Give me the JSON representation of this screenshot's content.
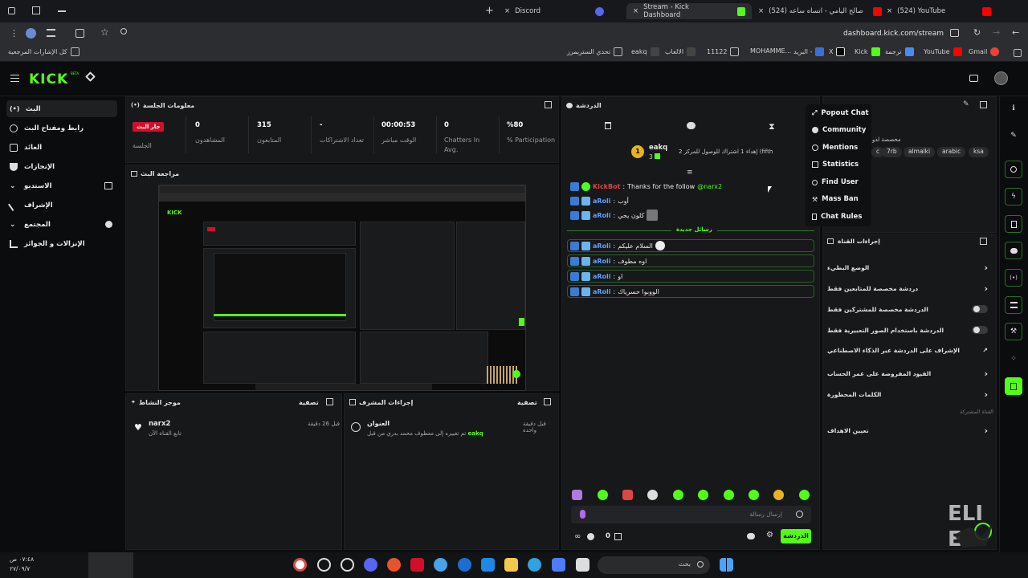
{
  "browser": {
    "tabs": [
      {
        "label": "Discord"
      },
      {
        "label": "Stream - Kick Dashboard"
      },
      {
        "label": "(524) صالح اليامي - اتساه ساعه"
      },
      {
        "label": "(524) YouTube"
      }
    ],
    "url": "dashboard.kick.com/stream",
    "bookmarks": [
      "كل الإشارات المرجعية",
      "تحدي الستريمرز",
      "eakq",
      "الالعاب",
      "11122",
      "MOHAMME...",
      "البريد -",
      "X",
      "Kick",
      "ترجمة",
      "YouTube",
      "Gmail"
    ]
  },
  "nav": {
    "items": [
      {
        "label": "البث",
        "icon": "broadcast-icon"
      },
      {
        "label": "رابط ومفتاح البث",
        "icon": "link-icon"
      },
      {
        "label": "العائد",
        "icon": "chart-icon"
      },
      {
        "label": "الإنجازات",
        "icon": "trophy-icon"
      },
      {
        "label": "الاستديو",
        "icon": "studio-icon"
      },
      {
        "label": "الإشراف",
        "icon": "moderation-icon"
      },
      {
        "label": "المجتمع",
        "icon": "community-icon"
      },
      {
        "label": "الإنزالات و الجوائز",
        "icon": "drops-icon"
      }
    ]
  },
  "session": {
    "title": "معلومات الجلسة",
    "live_badge": "جار البث",
    "live_sub": "الجلسة",
    "stats": [
      {
        "value": "0",
        "label": "المشاهدون"
      },
      {
        "value": "315",
        "label": "المتابعون"
      },
      {
        "value": "-",
        "label": "تعداد الاشتراكات"
      },
      {
        "value": "00:00:53",
        "label": "الوقت مباشر"
      },
      {
        "value": "0",
        "label": "Chatters In Avg."
      },
      {
        "value": "%80",
        "label": "% Participation"
      }
    ]
  },
  "preview": {
    "title": "مراجعة البث"
  },
  "activity": {
    "title": "موجز النشاط",
    "filter": "تصفية",
    "item": {
      "user": "narx2",
      "action": "تابع القناة الآن",
      "time": "قبل 26 دقيقة"
    }
  },
  "modactions": {
    "title": "إجراءات المشرف",
    "filter": "تصفية",
    "item": {
      "heading": "العنوان",
      "text": "تم تغييره إلى معطوف محمد بدري من قبل",
      "user": "eakq",
      "time": "قبل دقيقة واحدة"
    }
  },
  "chat": {
    "title": "الدردشة",
    "pinned": {
      "user": "eakq",
      "count": "3",
      "text": "إهداء 1 اشتراك للوصول للمركز 2 (fifth"
    },
    "messages": [
      {
        "user": "KickBot",
        "text": "Thanks for the follow",
        "mention": "@narx2"
      },
      {
        "user": "aRoli",
        "text": "أوب"
      },
      {
        "user": "aRoli",
        "text": "كلون يحي"
      }
    ],
    "new_divider": "رسائل جديدة",
    "new_messages": [
      {
        "user": "aRoli",
        "text": "السلام عليكم"
      },
      {
        "user": "aRoli",
        "text": "اوه مطوف"
      },
      {
        "user": "aRoli",
        "text": "او"
      },
      {
        "user": "aRoli",
        "text": "الووبوا حسرياك"
      }
    ],
    "input_placeholder": "إرسال رسالة",
    "viewer_count": "0",
    "send_label": "الدردشة"
  },
  "menu": {
    "items": [
      "Popout Chat",
      "Community",
      "Mentions",
      "Statistics",
      "Find User",
      "Mass Ban",
      "Chat Rules"
    ]
  },
  "tags": [
    "arabic",
    "ksa",
    "almalki",
    "7rb"
  ],
  "channel_actions": {
    "title": "إجراءات القناة",
    "rows": [
      {
        "label": "الوضع البطيء",
        "control": "chevron"
      },
      {
        "label": "دردشة مخصصة للمتابعين فقط",
        "control": "chevron"
      },
      {
        "label": "الدردشة مخصصة للمشتركين فقط",
        "control": "toggle"
      },
      {
        "label": "الدردشة باستخدام الصور التعبيرية فقط",
        "control": "toggle"
      },
      {
        "label": "الإشراف على الدردشة عبر الذكاء الاصطناعي",
        "control": "external"
      },
      {
        "label": "القيود المفروضة على عمر الحساب",
        "control": "chevron"
      },
      {
        "label": "الكلمات المحظورة",
        "control": "chevron"
      }
    ],
    "section": "القناة المشتركة",
    "goals": "تعيين الاهداف"
  },
  "partial_panel": {
    "text": "مخصصة لذو",
    "ctext": "c"
  },
  "clock": {
    "time": "٠٧:٤٨ ص",
    "date": "٢٧/٠٩/٧"
  },
  "taskbar": {
    "search": "بحث"
  },
  "colors": {
    "kick_green": "#53fc18",
    "bg": "#0b0c0d",
    "panel": "#17181a"
  }
}
